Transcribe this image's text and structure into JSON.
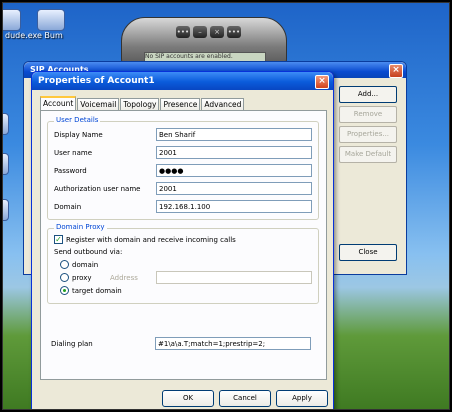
{
  "desktop": {
    "icons": [
      {
        "label": "",
        "name": "desktop-app-icon-1"
      },
      {
        "label": "dude.exe Bum",
        "name": "desktop-app-icon-2"
      }
    ]
  },
  "softphone": {
    "screen_text": "No SIP accounts are enabled."
  },
  "accounts_window": {
    "title": "SIP Accounts",
    "buttons": {
      "add": "Add...",
      "remove": "Remove",
      "properties": "Properties...",
      "make_default": "Make Default",
      "close": "Close"
    }
  },
  "dialog": {
    "title": "Properties of Account1",
    "tabs": [
      "Account",
      "Voicemail",
      "Topology",
      "Presence",
      "Advanced"
    ],
    "active_tab": "Account",
    "user_details": {
      "group_title": "User Details",
      "display_name_label": "Display Name",
      "display_name_value": "Ben Sharif",
      "user_name_label": "User name",
      "user_name_value": "2001",
      "password_label": "Password",
      "password_value": "●●●●",
      "auth_user_label": "Authorization user name",
      "auth_user_value": "2001",
      "domain_label": "Domain",
      "domain_value": "192.168.1.100"
    },
    "domain_proxy": {
      "group_title": "Domain Proxy",
      "register_label": "Register with domain and receive incoming calls",
      "register_checked": true,
      "send_outbound_label": "Send outbound via:",
      "option_domain": "domain",
      "option_proxy": "proxy",
      "address_label": "Address",
      "address_value": "",
      "option_target": "target domain",
      "selected_option": "target domain"
    },
    "dialing_plan_label": "Dialing plan",
    "dialing_plan_value": "#1\\a\\a.T;match=1;prestrip=2;",
    "buttons": {
      "ok": "OK",
      "cancel": "Cancel",
      "apply": "Apply"
    }
  },
  "colors": {
    "title_bar": "#0a5bdb",
    "dialog_bg": "#ece9d8",
    "group_title": "#0046d5",
    "check_mark": "#21a121"
  }
}
